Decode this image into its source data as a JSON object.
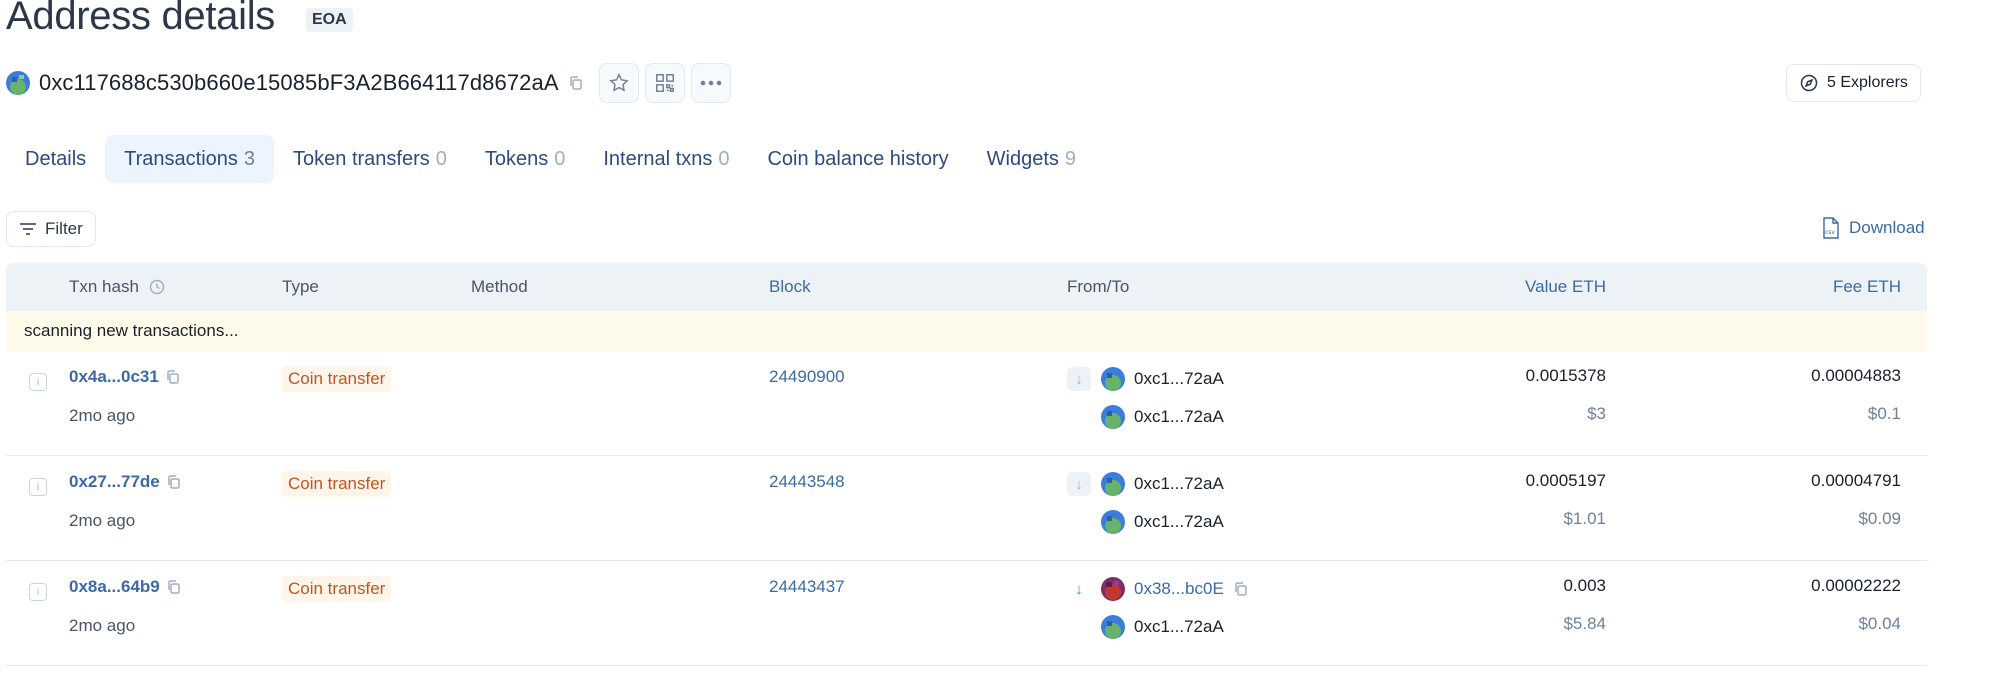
{
  "header": {
    "title": "Address details",
    "badge": "EOA",
    "address": "0xc117688c530b660e15085bF3A2B664117d8672aA",
    "explorers_label": "5 Explorers"
  },
  "tabs": [
    {
      "label": "Details",
      "count": ""
    },
    {
      "label": "Transactions",
      "count": "3"
    },
    {
      "label": "Token transfers",
      "count": "0"
    },
    {
      "label": "Tokens",
      "count": "0"
    },
    {
      "label": "Internal txns",
      "count": "0"
    },
    {
      "label": "Coin balance history",
      "count": ""
    },
    {
      "label": "Widgets",
      "count": "9"
    }
  ],
  "active_tab": "Transactions",
  "toolbar": {
    "filter_label": "Filter",
    "download_label": "Download"
  },
  "table": {
    "headers": {
      "txn_hash": "Txn hash",
      "type": "Type",
      "method": "Method",
      "block": "Block",
      "from_to": "From/To",
      "value": "Value ETH",
      "fee": "Fee ETH"
    },
    "scanning_text": "scanning new transactions...",
    "rows": [
      {
        "hash": "0x4a...0c31",
        "age": "2mo ago",
        "type": "Coin transfer",
        "block": "24490900",
        "direction": "in",
        "from": "0xc1...72aA",
        "to": "0xc1...72aA",
        "value": "0.0015378",
        "value_usd": "$3",
        "fee": "0.00004883",
        "fee_usd": "$0.1"
      },
      {
        "hash": "0x27...77de",
        "age": "2mo ago",
        "type": "Coin transfer",
        "block": "24443548",
        "direction": "in",
        "from": "0xc1...72aA",
        "to": "0xc1...72aA",
        "value": "0.0005197",
        "value_usd": "$1.01",
        "fee": "0.00004791",
        "fee_usd": "$0.09"
      },
      {
        "hash": "0x8a...64b9",
        "age": "2mo ago",
        "type": "Coin transfer",
        "block": "24443437",
        "direction": "in-external",
        "from": "0x38...bc0E",
        "to": "0xc1...72aA",
        "value": "0.003",
        "value_usd": "$5.84",
        "fee": "0.00002222",
        "fee_usd": "$0.04"
      }
    ]
  },
  "colors": {
    "link": "#3c6aa6",
    "badge_bg": "#fff5eb",
    "badge_text": "#c05621",
    "scan_bg": "#fffbeb",
    "header_bg": "#edf2f7",
    "active_tab_bg": "#ebf4ff"
  }
}
